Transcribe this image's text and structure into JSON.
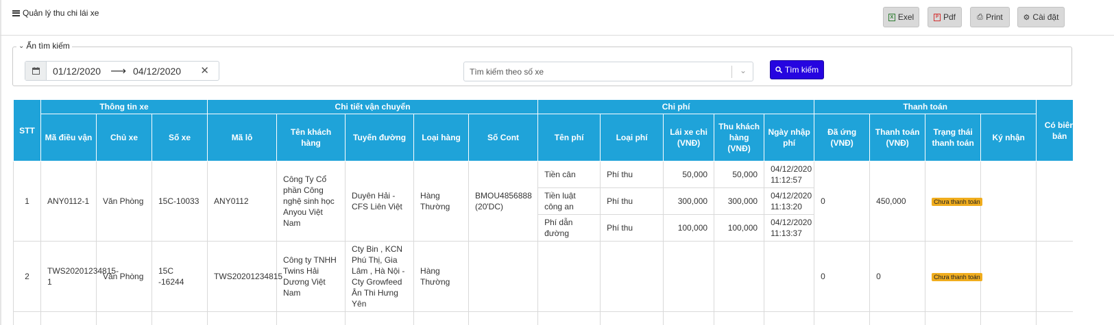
{
  "header": {
    "title": "Quản lý thu chi lái xe",
    "buttons": {
      "excel": "Exel",
      "pdf": "Pdf",
      "print": "Print",
      "settings": "Cài đặt"
    }
  },
  "search": {
    "toggle_label": "Ẩn tìm kiếm",
    "date_from": "01/12/2020",
    "date_to": "04/12/2020",
    "vehicle_placeholder": "Tìm kiếm theo số xe",
    "search_button": "Tìm kiếm"
  },
  "table": {
    "groups": {
      "stt": "STT",
      "vehicle_info": "Thông tin xe",
      "transport_detail": "Chi tiết vận chuyển",
      "costs": "Chi phí",
      "payment": "Thanh toán",
      "minutes": "Có biên bản"
    },
    "columns": {
      "dispatch_code": "Mã điều vận",
      "owner": "Chủ xe",
      "plate": "Số xe",
      "lot_code": "Mã lô",
      "customer": "Tên khách hàng",
      "route": "Tuyến đường",
      "cargo_type": "Loại hàng",
      "container": "Số Cont",
      "fee_name": "Tên phí",
      "fee_type": "Loại phí",
      "driver_spent": "Lái xe chi (VNĐ)",
      "customer_paid": "Thu khách hàng (VNĐ)",
      "entry_date": "Ngày nhập phí",
      "advanced": "Đã ứng (VNĐ)",
      "payment_amount": "Thanh toán (VNĐ)",
      "payment_status": "Trạng thái thanh toán",
      "signed": "Ký nhận"
    },
    "rows": [
      {
        "stt": "1",
        "dispatch_code": "ANY0112-1",
        "owner": "Văn Phòng",
        "plate": "15C-10033",
        "lot_code": "ANY0112",
        "customer": "Công Ty Cổ phần Công nghệ sinh học Anyou Việt Nam",
        "route": "Duyên Hải - CFS Liên Việt",
        "cargo_type": "Hàng Thường",
        "container": "BMOU4856888 (20'DC)",
        "fees": [
          {
            "name": "Tiền cân",
            "type": "Phí thu",
            "driver": "50,000",
            "customer": "50,000",
            "date": "04/12/2020 11:12:57"
          },
          {
            "name": "Tiền luật công an",
            "type": "Phí thu",
            "driver": "300,000",
            "customer": "300,000",
            "date": "04/12/2020 11:13:20"
          },
          {
            "name": "Phí dẫn đường",
            "type": "Phí thu",
            "driver": "100,000",
            "customer": "100,000",
            "date": "04/12/2020 11:13:37"
          }
        ],
        "advanced": "0",
        "payment_amount": "450,000",
        "payment_status": "Chưa thanh toán"
      },
      {
        "stt": "2",
        "dispatch_code": "TWS20201234815-1",
        "owner": "Văn Phòng",
        "plate": "15C -16244",
        "lot_code": "TWS20201234815",
        "customer": "Công ty TNHH Twins Hải Dương Việt Nam",
        "route": "Cty Bin , KCN Phú Thị, Gia Lâm , Hà Nội - Cty Growfeed Ân Thi Hưng Yên",
        "cargo_type": "Hàng Thường",
        "container": "",
        "advanced": "0",
        "payment_amount": "0",
        "payment_status": "Chưa thanh toán"
      }
    ]
  },
  "colors": {
    "header_blue": "#1fa3d9",
    "search_button": "#2605e0",
    "badge": "#f0ad1e"
  }
}
